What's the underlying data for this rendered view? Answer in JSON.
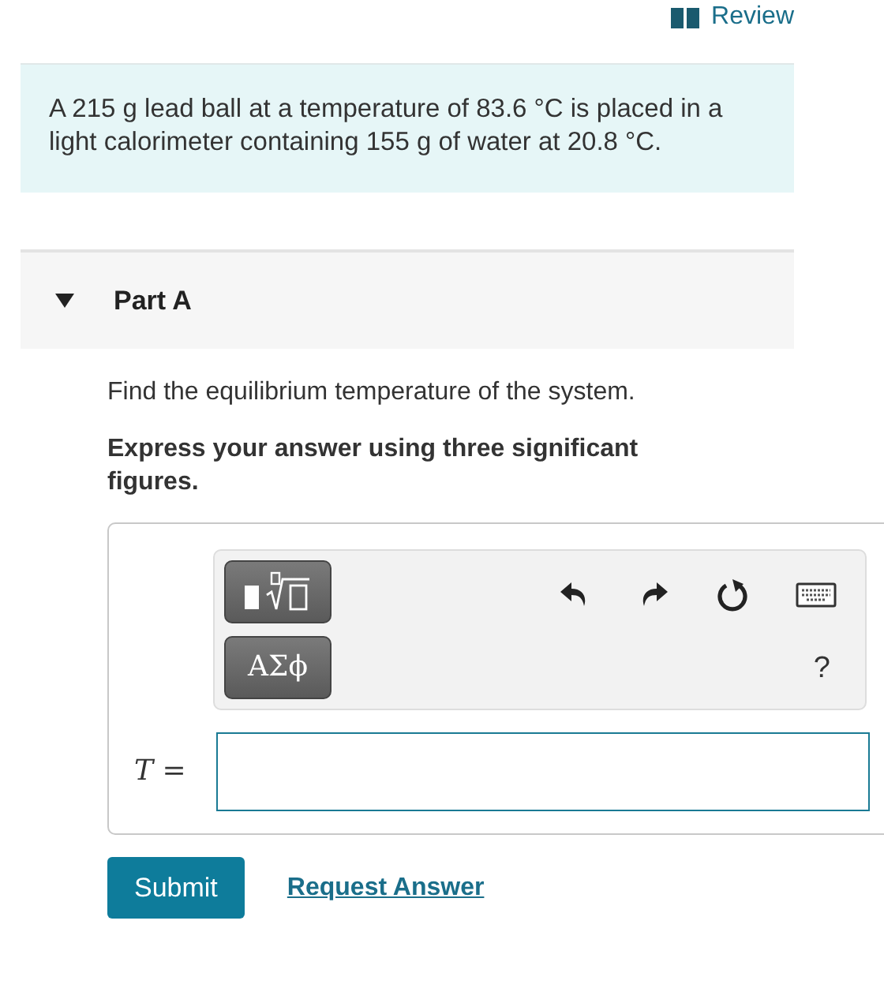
{
  "review_link": "Review",
  "problem": "A 215 g lead ball at a temperature of 83.6 °C is placed in a light calorimeter containing 155 g of water at 20.8 °C.",
  "part": {
    "title": "Part A",
    "expanded": true
  },
  "question": "Find the equilibrium temperature of the system.",
  "instruction": "Express your answer using three significant figures.",
  "toolbar": {
    "symbols_button": "ΑΣϕ",
    "help_button": "?"
  },
  "answer": {
    "label": "*T* ="
  },
  "buttons": {
    "submit": "Submit",
    "request": "Request Answer"
  }
}
